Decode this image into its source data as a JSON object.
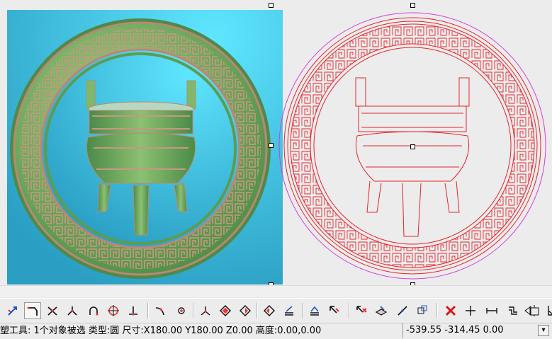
{
  "colors": {
    "relief_background": "#3fb4d8",
    "relief_green": "#6fae5e",
    "relief_ridge": "#c08a78",
    "vector_red": "#e8232b",
    "selection_magenta": "#d63be0",
    "canvas_background": "#ececec"
  },
  "toolbar": {
    "icons": [
      "select-arrow-icon",
      "polyline-corner-icon",
      "trim-cross-icon",
      "extend-icon",
      "arc-tool-icon",
      "circle-node-icon",
      "perpendicular-icon",
      "fillet-icon",
      "weld-node-icon",
      "axis-icon",
      "boolean-union-icon",
      "boolean-subtract-icon",
      "boolean-intersect-icon",
      "align-icon",
      "distribute-icon",
      "pick-point-icon",
      "delete-point-icon",
      "layer-icon",
      "break-icon",
      "group-icon",
      "delete-icon",
      "move-icon",
      "measure-icon",
      "offset-icon",
      "scale-icon",
      "angle-icon",
      "more-icon"
    ]
  },
  "status": {
    "message": "塑工具: 1个对象被选 类型:圆 尺寸:X180.00 Y180.00 Z0.00 高度:0.00,0.00",
    "coordinates": "-539.55 -314.45 0.00"
  }
}
